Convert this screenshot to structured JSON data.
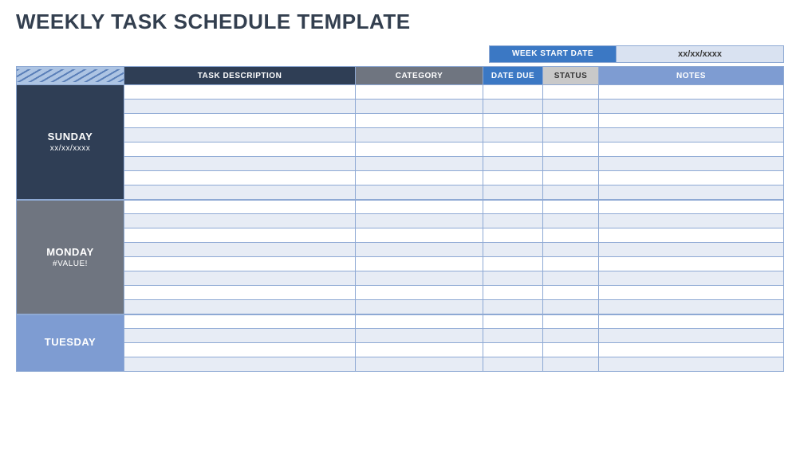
{
  "title": "WEEKLY TASK SCHEDULE TEMPLATE",
  "week_start": {
    "label": "WEEK START DATE",
    "value": "xx/xx/xxxx"
  },
  "columns": {
    "task_description": "TASK DESCRIPTION",
    "category": "CATEGORY",
    "date_due": "DATE DUE",
    "status": "STATUS",
    "notes": "NOTES"
  },
  "days": [
    {
      "name": "SUNDAY",
      "date": "xx/xx/xxxx",
      "theme": "day-sun",
      "rows": 8
    },
    {
      "name": "MONDAY",
      "date": "#VALUE!",
      "theme": "day-mon",
      "rows": 8
    },
    {
      "name": "TUESDAY",
      "date": "",
      "theme": "day-tue",
      "rows": 4
    }
  ]
}
